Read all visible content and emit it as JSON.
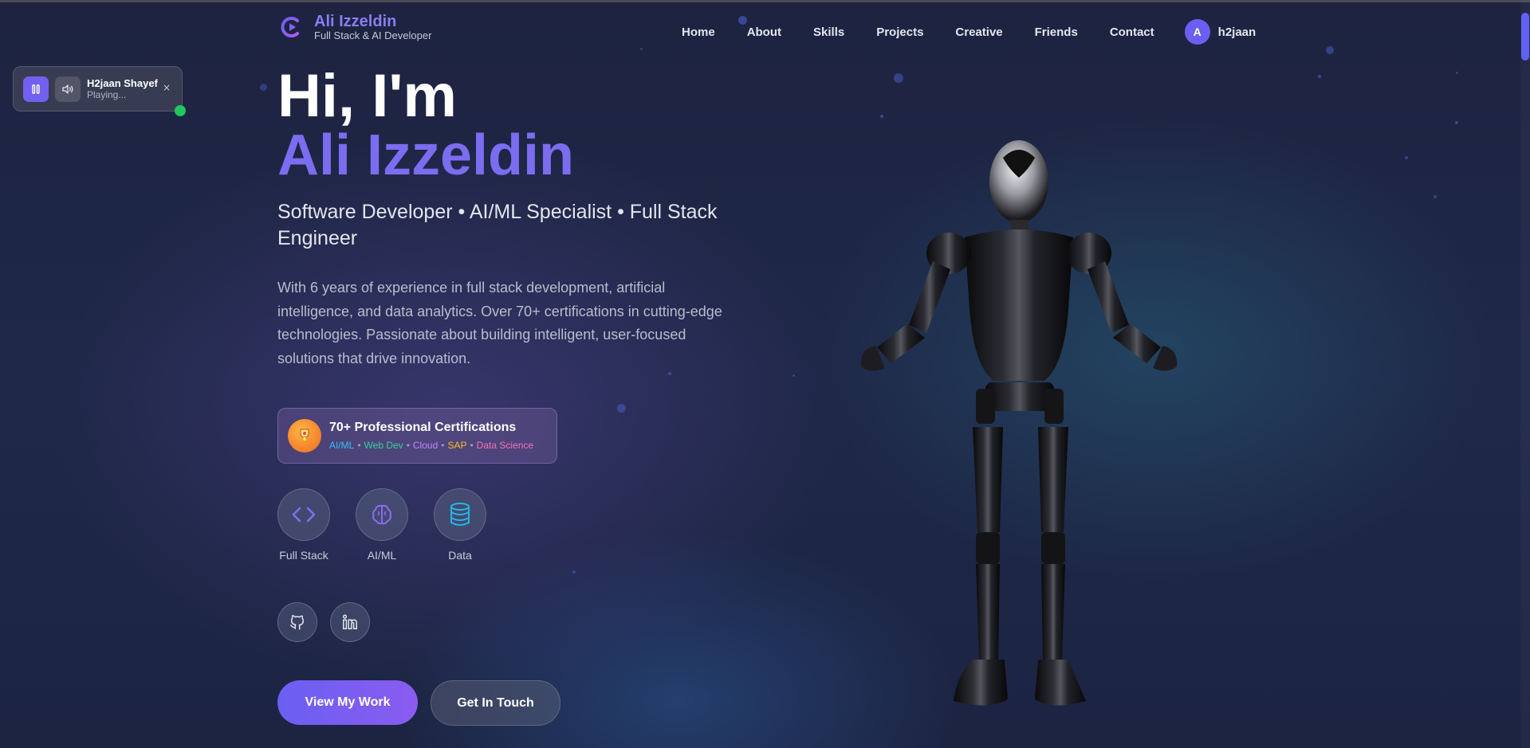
{
  "header": {
    "brand_name": "Ali Izzeldin",
    "brand_sub": "Full Stack & AI Developer",
    "nav": [
      "Home",
      "About",
      "Skills",
      "Projects",
      "Creative",
      "Friends",
      "Contact"
    ],
    "user_initial": "A",
    "user_name": "h2jaan"
  },
  "player": {
    "title": "H2jaan Shayef",
    "status": "Playing...",
    "close": "×"
  },
  "hero": {
    "greeting": "Hi, I'm",
    "name": "Ali Izzeldin",
    "tagline": "Software Developer • AI/ML Specialist • Full Stack Engineer",
    "description": "With 6 years of experience in full stack development, artificial intelligence, and data analytics. Over 70+ certifications in cutting-edge technologies. Passionate about building intelligent, user-focused solutions that drive innovation."
  },
  "cert": {
    "title": "70+ Professional Certifications",
    "tags": [
      {
        "label": "AI/ML",
        "color": "#38bdf8"
      },
      {
        "label": "Web Dev",
        "color": "#34d399"
      },
      {
        "label": "Cloud",
        "color": "#c084fc"
      },
      {
        "label": "SAP",
        "color": "#fbbf24"
      },
      {
        "label": "Data Science",
        "color": "#f472b6"
      }
    ]
  },
  "skills": [
    {
      "label": "Full Stack",
      "icon": "code-icon",
      "color": "#7b73f5"
    },
    {
      "label": "AI/ML",
      "icon": "brain-icon",
      "color": "#8b6cf0"
    },
    {
      "label": "Data",
      "icon": "database-icon",
      "color": "#22b8e6"
    }
  ],
  "socials": [
    {
      "icon": "github-icon"
    },
    {
      "icon": "linkedin-icon"
    }
  ],
  "cta": {
    "primary": "View My Work",
    "secondary": "Get In Touch"
  },
  "colors": {
    "accent": "#7b6cf0",
    "background": "#1f2849",
    "online": "#22c55e"
  }
}
